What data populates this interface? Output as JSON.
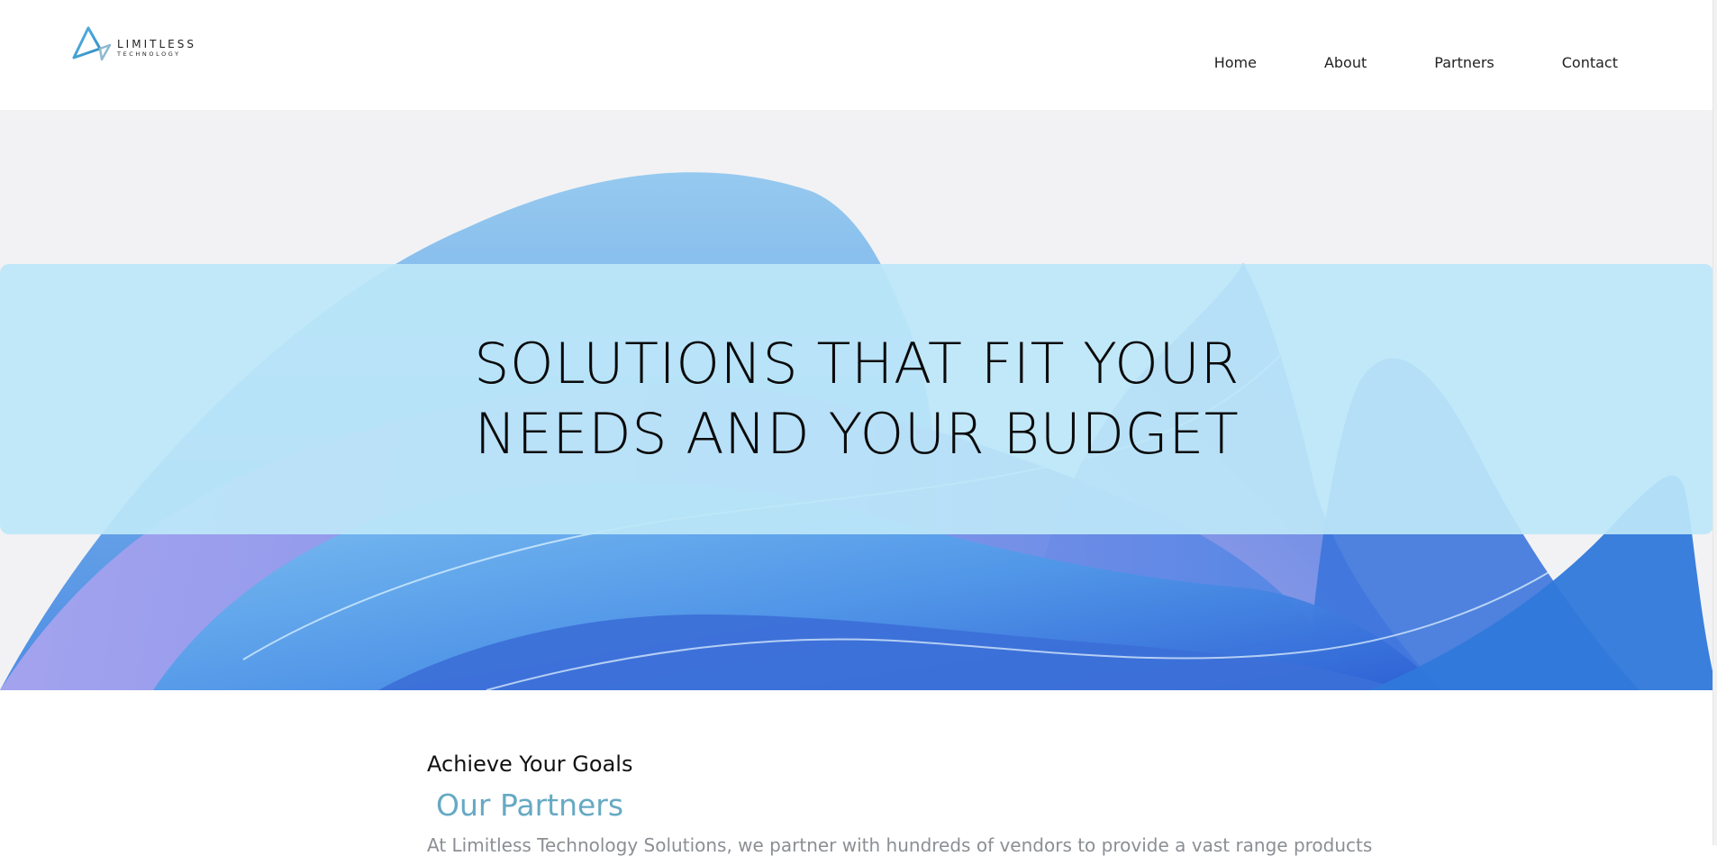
{
  "brand": {
    "logo_line1": "LIMITLESS",
    "logo_line2": "TECHNOLOGY"
  },
  "nav": {
    "items": [
      "Home",
      "About",
      "Partners",
      "Contact"
    ]
  },
  "hero": {
    "heading_line1": "SOLUTIONS THAT FIT YOUR",
    "heading_line2": "NEEDS AND YOUR BUDGET"
  },
  "content": {
    "kicker": "Achieve Your Goals",
    "title": "Our Partners",
    "body_partial": "At Limitless Technology Solutions, we partner with hundreds of vendors to provide a vast range products"
  },
  "colors": {
    "accent_blue": "#66a9c3",
    "hero_band": "#bde7f8",
    "text_dark": "#111111",
    "body_gray": "#8b8f94"
  },
  "icons": {
    "logo_mark": "triangle-logo-icon"
  }
}
